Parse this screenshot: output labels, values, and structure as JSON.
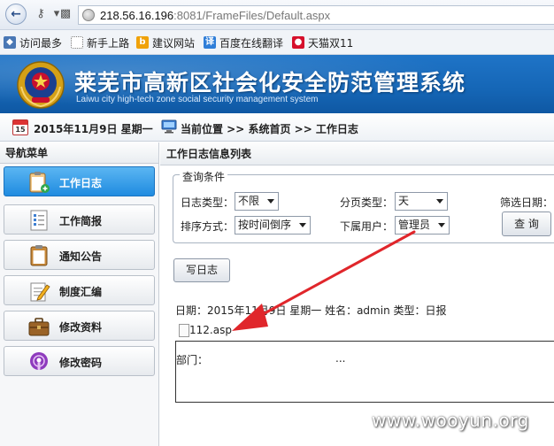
{
  "browser": {
    "url_host": "218.56.16.196",
    "url_path": ":8081/FrameFiles/Default.aspx",
    "bookmarks": [
      {
        "label": "访问最多",
        "icon": "bookmark-icon"
      },
      {
        "label": "新手上路",
        "icon": "dotted-page-icon"
      },
      {
        "label": "建议网站",
        "icon": "bing-icon"
      },
      {
        "label": "百度在线翻译",
        "icon": "translate-icon"
      },
      {
        "label": "天猫双11",
        "icon": "tmall-icon"
      }
    ]
  },
  "banner": {
    "title": "莱芜市高新区社会化安全防范管理系统",
    "subtitle": "Laiwu city high-tech zone social security management system"
  },
  "infobar": {
    "calendar_day": "15",
    "date": "2015年11月9日 星期一",
    "location": "当前位置  >> 系统首页  >> 工作日志"
  },
  "sidebar": {
    "title": "导航菜单",
    "items": [
      {
        "label": "工作日志",
        "icon": "clipboard-plus-icon",
        "active": true
      },
      {
        "label": "工作简报",
        "icon": "document-list-icon",
        "active": false
      },
      {
        "label": "通知公告",
        "icon": "clipboard-icon",
        "active": false
      },
      {
        "label": "制度汇编",
        "icon": "pencil-note-icon",
        "active": false
      },
      {
        "label": "修改资料",
        "icon": "briefcase-icon",
        "active": false
      },
      {
        "label": "修改密码",
        "icon": "podcast-lock-icon",
        "active": false
      }
    ]
  },
  "main": {
    "title": "工作日志信息列表",
    "query": {
      "legend": "查询条件",
      "log_type_label": "日志类型：",
      "log_type_value": "不限",
      "page_type_label": "分页类型：",
      "page_type_value": "天",
      "filter_date_label": "筛选日期：",
      "sort_label": "排序方式：",
      "sort_value": "按时间倒序",
      "sub_user_label": "下属用户：",
      "sub_user_value": "管理员",
      "query_button": "查 询"
    },
    "write_log_button": "写日志",
    "log_meta": "日期：2015年11月9日  星期一   姓名：admin   类型：日报",
    "file_name": "112.asp",
    "dept_label": "部门：",
    "dept_value": "..."
  },
  "colors": {
    "banner": "#1566b6",
    "active_menu": "#1f8be0",
    "annotation_arrow": "#e0262b"
  },
  "watermark": "www.wooyun.org"
}
